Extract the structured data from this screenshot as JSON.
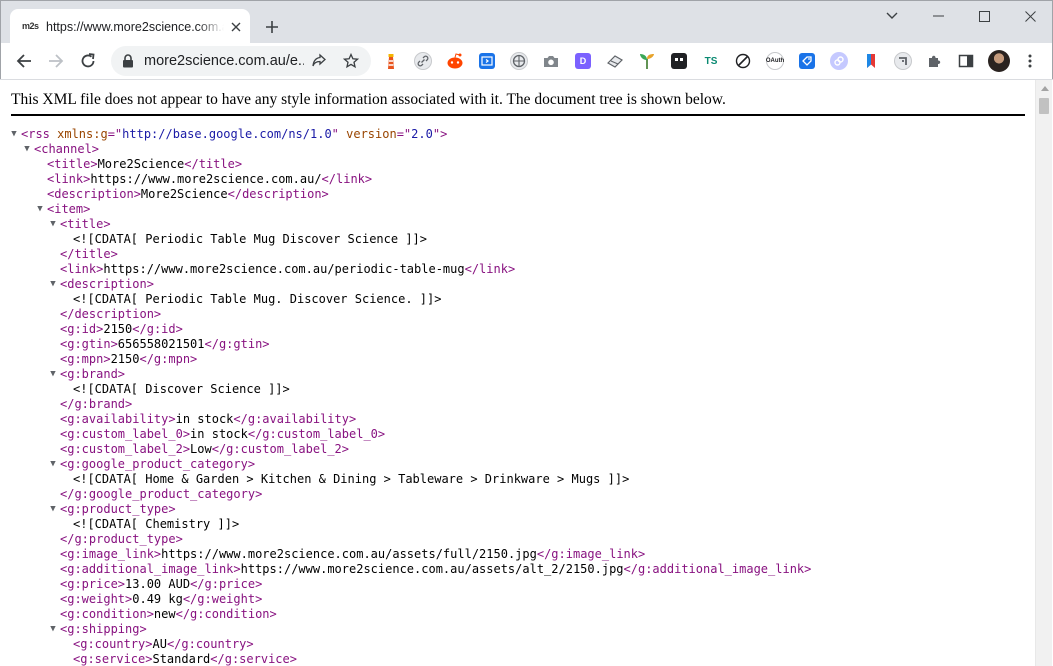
{
  "window": {
    "tab": {
      "favicon_text": "m2s",
      "title": "https://www.more2science.com.au/"
    }
  },
  "toolbar": {
    "url": "more2science.com.au/e...",
    "extensions": [
      {
        "name": "extension-lighthouse-icon",
        "color": "#e8541d"
      },
      {
        "name": "extension-link-icon",
        "color": "#5f6368"
      },
      {
        "name": "extension-reddit-icon",
        "color": "#ff4500"
      },
      {
        "name": "extension-code-icon",
        "color": "#1a73e8"
      },
      {
        "name": "extension-globe-icon",
        "color": "#5f6368"
      },
      {
        "name": "extension-camera-icon",
        "color": "#5f6368"
      },
      {
        "name": "extension-d-icon",
        "color": "#7b61ff"
      },
      {
        "name": "extension-eraser-icon",
        "color": "#5f6368"
      },
      {
        "name": "extension-leaf-icon",
        "color": "#3aa757"
      },
      {
        "name": "extension-tab-icon",
        "color": "#202124"
      },
      {
        "name": "extension-ts-icon",
        "color": "#0b8a72"
      },
      {
        "name": "extension-feather-icon",
        "color": "#202124"
      },
      {
        "name": "extension-oauth-icon",
        "color": "#202124"
      },
      {
        "name": "extension-tag-icon",
        "color": "#1a73e8"
      },
      {
        "name": "extension-chain-icon",
        "color": "#a0a0ff"
      },
      {
        "name": "extension-bookmark-icon",
        "color": "#e53935"
      },
      {
        "name": "extension-arrow-icon",
        "color": "#5f6368"
      }
    ],
    "ext_labels": {
      "d": "D",
      "ts": "TS",
      "oauth": "OAuth"
    }
  },
  "content": {
    "notice": "This XML file does not appear to have any style information associated with it. The document tree is shown below.",
    "lines": [
      {
        "indent": 0,
        "toggle": true,
        "parts": [
          [
            "tag",
            "<rss "
          ],
          [
            "attr",
            "xmlns:g"
          ],
          [
            "tag",
            "=\""
          ],
          [
            "attrval",
            "http://base.google.com/ns/1.0"
          ],
          [
            "tag",
            "\" "
          ],
          [
            "attr",
            "version"
          ],
          [
            "tag",
            "=\""
          ],
          [
            "attrval",
            "2.0"
          ],
          [
            "tag",
            "\">"
          ]
        ]
      },
      {
        "indent": 1,
        "toggle": true,
        "parts": [
          [
            "tag",
            "<channel>"
          ]
        ]
      },
      {
        "indent": 2,
        "toggle": false,
        "parts": [
          [
            "tag",
            "<title>"
          ],
          [
            "txt",
            "More2Science"
          ],
          [
            "tag",
            "</title>"
          ]
        ]
      },
      {
        "indent": 2,
        "toggle": false,
        "parts": [
          [
            "tag",
            "<link>"
          ],
          [
            "txt",
            "https://www.more2science.com.au/"
          ],
          [
            "tag",
            "</link>"
          ]
        ]
      },
      {
        "indent": 2,
        "toggle": false,
        "parts": [
          [
            "tag",
            "<description>"
          ],
          [
            "txt",
            "More2Science"
          ],
          [
            "tag",
            "</description>"
          ]
        ]
      },
      {
        "indent": 2,
        "toggle": true,
        "parts": [
          [
            "tag",
            "<item>"
          ]
        ]
      },
      {
        "indent": 3,
        "toggle": true,
        "parts": [
          [
            "tag",
            "<title>"
          ]
        ]
      },
      {
        "indent": 4,
        "toggle": false,
        "parts": [
          [
            "txt",
            "<![CDATA[ Periodic Table Mug Discover Science ]]>"
          ]
        ]
      },
      {
        "indent": 3,
        "toggle": false,
        "parts": [
          [
            "tag",
            "</title>"
          ]
        ]
      },
      {
        "indent": 3,
        "toggle": false,
        "parts": [
          [
            "tag",
            "<link>"
          ],
          [
            "txt",
            "https://www.more2science.com.au/periodic-table-mug"
          ],
          [
            "tag",
            "</link>"
          ]
        ]
      },
      {
        "indent": 3,
        "toggle": true,
        "parts": [
          [
            "tag",
            "<description>"
          ]
        ]
      },
      {
        "indent": 4,
        "toggle": false,
        "parts": [
          [
            "txt",
            "<![CDATA[ Periodic Table Mug. Discover Science. ]]>"
          ]
        ]
      },
      {
        "indent": 3,
        "toggle": false,
        "parts": [
          [
            "tag",
            "</description>"
          ]
        ]
      },
      {
        "indent": 3,
        "toggle": false,
        "parts": [
          [
            "tag",
            "<g:id>"
          ],
          [
            "txt",
            "2150"
          ],
          [
            "tag",
            "</g:id>"
          ]
        ]
      },
      {
        "indent": 3,
        "toggle": false,
        "parts": [
          [
            "tag",
            "<g:gtin>"
          ],
          [
            "txt",
            "656558021501"
          ],
          [
            "tag",
            "</g:gtin>"
          ]
        ]
      },
      {
        "indent": 3,
        "toggle": false,
        "parts": [
          [
            "tag",
            "<g:mpn>"
          ],
          [
            "txt",
            "2150"
          ],
          [
            "tag",
            "</g:mpn>"
          ]
        ]
      },
      {
        "indent": 3,
        "toggle": true,
        "parts": [
          [
            "tag",
            "<g:brand>"
          ]
        ]
      },
      {
        "indent": 4,
        "toggle": false,
        "parts": [
          [
            "txt",
            "<![CDATA[ Discover Science ]]>"
          ]
        ]
      },
      {
        "indent": 3,
        "toggle": false,
        "parts": [
          [
            "tag",
            "</g:brand>"
          ]
        ]
      },
      {
        "indent": 3,
        "toggle": false,
        "parts": [
          [
            "tag",
            "<g:availability>"
          ],
          [
            "txt",
            "in stock"
          ],
          [
            "tag",
            "</g:availability>"
          ]
        ]
      },
      {
        "indent": 3,
        "toggle": false,
        "parts": [
          [
            "tag",
            "<g:custom_label_0>"
          ],
          [
            "txt",
            "in stock"
          ],
          [
            "tag",
            "</g:custom_label_0>"
          ]
        ]
      },
      {
        "indent": 3,
        "toggle": false,
        "parts": [
          [
            "tag",
            "<g:custom_label_2>"
          ],
          [
            "txt",
            "Low"
          ],
          [
            "tag",
            "</g:custom_label_2>"
          ]
        ]
      },
      {
        "indent": 3,
        "toggle": true,
        "parts": [
          [
            "tag",
            "<g:google_product_category>"
          ]
        ]
      },
      {
        "indent": 4,
        "toggle": false,
        "parts": [
          [
            "txt",
            "<![CDATA[ Home & Garden > Kitchen & Dining > Tableware > Drinkware > Mugs ]]>"
          ]
        ]
      },
      {
        "indent": 3,
        "toggle": false,
        "parts": [
          [
            "tag",
            "</g:google_product_category>"
          ]
        ]
      },
      {
        "indent": 3,
        "toggle": true,
        "parts": [
          [
            "tag",
            "<g:product_type>"
          ]
        ]
      },
      {
        "indent": 4,
        "toggle": false,
        "parts": [
          [
            "txt",
            "<![CDATA[ Chemistry ]]>"
          ]
        ]
      },
      {
        "indent": 3,
        "toggle": false,
        "parts": [
          [
            "tag",
            "</g:product_type>"
          ]
        ]
      },
      {
        "indent": 3,
        "toggle": false,
        "parts": [
          [
            "tag",
            "<g:image_link>"
          ],
          [
            "txt",
            "https://www.more2science.com.au/assets/full/2150.jpg"
          ],
          [
            "tag",
            "</g:image_link>"
          ]
        ]
      },
      {
        "indent": 3,
        "toggle": false,
        "parts": [
          [
            "tag",
            "<g:additional_image_link>"
          ],
          [
            "txt",
            "https://www.more2science.com.au/assets/alt_2/2150.jpg"
          ],
          [
            "tag",
            "</g:additional_image_link>"
          ]
        ]
      },
      {
        "indent": 3,
        "toggle": false,
        "parts": [
          [
            "tag",
            "<g:price>"
          ],
          [
            "txt",
            "13.00 AUD"
          ],
          [
            "tag",
            "</g:price>"
          ]
        ]
      },
      {
        "indent": 3,
        "toggle": false,
        "parts": [
          [
            "tag",
            "<g:weight>"
          ],
          [
            "txt",
            "0.49 kg"
          ],
          [
            "tag",
            "</g:weight>"
          ]
        ]
      },
      {
        "indent": 3,
        "toggle": false,
        "parts": [
          [
            "tag",
            "<g:condition>"
          ],
          [
            "txt",
            "new"
          ],
          [
            "tag",
            "</g:condition>"
          ]
        ]
      },
      {
        "indent": 3,
        "toggle": true,
        "parts": [
          [
            "tag",
            "<g:shipping>"
          ]
        ]
      },
      {
        "indent": 4,
        "toggle": false,
        "parts": [
          [
            "tag",
            "<g:country>"
          ],
          [
            "txt",
            "AU"
          ],
          [
            "tag",
            "</g:country>"
          ]
        ]
      },
      {
        "indent": 4,
        "toggle": false,
        "parts": [
          [
            "tag",
            "<g:service>"
          ],
          [
            "txt",
            "Standard"
          ],
          [
            "tag",
            "</g:service>"
          ]
        ]
      }
    ]
  }
}
